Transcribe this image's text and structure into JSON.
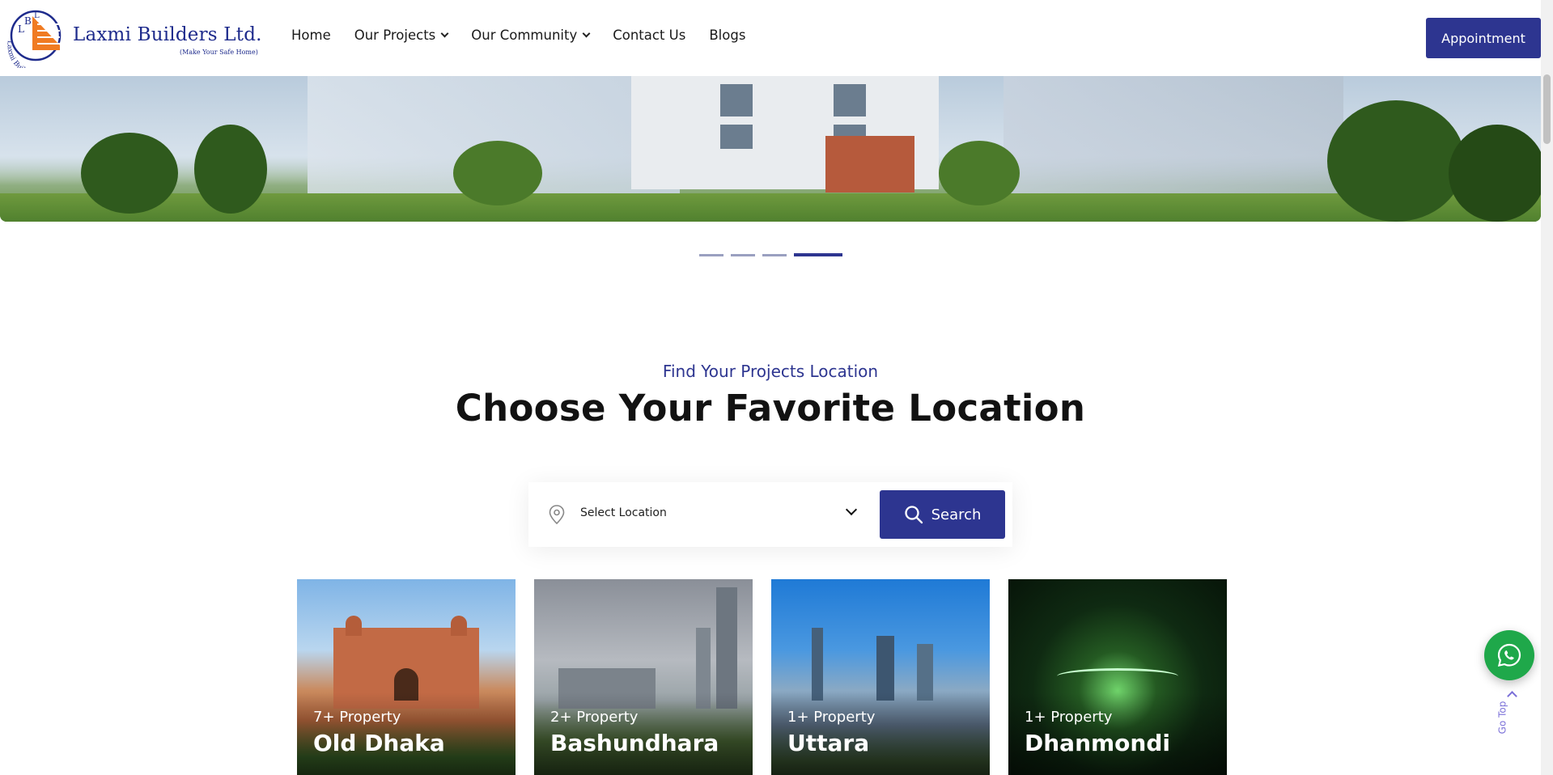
{
  "brand": {
    "name": "Laxmi Builders Ltd.",
    "tagline": "(Make Your Safe Home)",
    "monogram": "LBL",
    "ring_text": "Laxmi Builders Ltd."
  },
  "nav": {
    "items": [
      {
        "label": "Home",
        "has_dropdown": false
      },
      {
        "label": "Our Projects",
        "has_dropdown": true
      },
      {
        "label": "Our Community",
        "has_dropdown": true
      },
      {
        "label": "Contact Us",
        "has_dropdown": false
      },
      {
        "label": "Blogs",
        "has_dropdown": false
      }
    ],
    "cta_label": "Appointment"
  },
  "hero": {
    "slides_total": 4,
    "active_slide": 4
  },
  "locations": {
    "eyebrow": "Find Your Projects Location",
    "title": "Choose Your Favorite Location",
    "select_placeholder": "Select Location",
    "search_label": "Search",
    "cards": [
      {
        "count": "7+ Property",
        "name": "Old Dhaka"
      },
      {
        "count": "2+ Property",
        "name": "Bashundhara"
      },
      {
        "count": "1+ Property",
        "name": "Uttara"
      },
      {
        "count": "1+ Property",
        "name": "Dhanmondi"
      }
    ]
  },
  "floating": {
    "go_top_label": "Go Top",
    "whatsapp_icon": "whatsapp-icon"
  },
  "colors": {
    "primary": "#2d3590",
    "whatsapp": "#1fa84a",
    "go_top": "#7a6fd8"
  }
}
